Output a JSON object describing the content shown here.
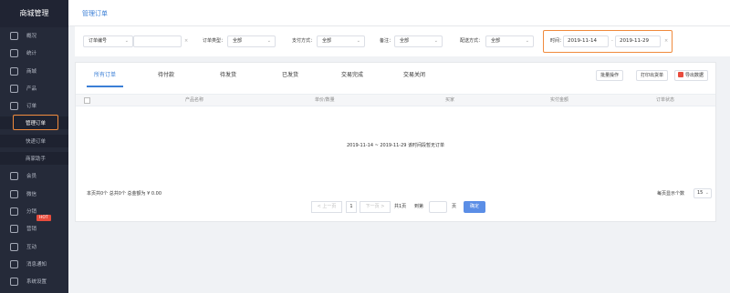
{
  "sidebar": {
    "brand": "商城管理",
    "items": [
      {
        "label": "概况",
        "icon": "monitor-icon"
      },
      {
        "label": "统计",
        "icon": "chart-icon"
      },
      {
        "label": "商城",
        "icon": "store-icon"
      },
      {
        "label": "产品",
        "icon": "grid-icon"
      },
      {
        "label": "订单",
        "icon": "clipboard-icon"
      },
      {
        "label": "会员",
        "icon": "user-group-icon"
      },
      {
        "label": "微信",
        "icon": "wechat-icon"
      },
      {
        "label": "分销",
        "icon": "share-icon"
      },
      {
        "label": "营销",
        "icon": "tag-icon"
      },
      {
        "label": "互动",
        "icon": "chat-icon"
      },
      {
        "label": "消息通知",
        "icon": "bell-icon"
      },
      {
        "label": "系统设置",
        "icon": "gear-icon"
      }
    ],
    "sub_items": [
      "管理订单",
      "快递订单",
      "商家助手"
    ],
    "hot_badge": "HOT"
  },
  "header": {
    "title": "管理订单"
  },
  "filters": {
    "order_no_select": "订单编号",
    "order_type_label": "订单类型：",
    "order_type_value": "全部",
    "pay_label": "支付方式：",
    "pay_value": "全部",
    "remark_label": "备注：",
    "remark_value": "全部",
    "delivery_label": "配送方式：",
    "delivery_value": "全部",
    "time_label": "时间：",
    "date_start": "2019-11-14",
    "date_end": "2019-11-29",
    "date_sep": "-",
    "clear": "×"
  },
  "tabs": [
    "所有订单",
    "待付款",
    "待发货",
    "已发货",
    "交易完成",
    "交易关闭"
  ],
  "toolbar": {
    "batch": "批量操作",
    "print": "打印出货单",
    "export": "导出数据"
  },
  "table": {
    "columns": [
      "产品名称",
      "单价/数量",
      "买家",
      "实付金额",
      "订单状态"
    ],
    "empty_text": "2019-11-14 ~ 2019-11-29 该时间段暂无订单"
  },
  "footer": {
    "summary": "本页共0个  总共0个  总金额为 ¥ 0.00",
    "page_size_label": "每页显示个数",
    "page_size_value": "15",
    "prev": "< 上一页",
    "page_num": "1",
    "next": "下一页 >",
    "total_pages": "共1页",
    "goto_label": "到第",
    "goto_unit": "页",
    "confirm": "确定"
  },
  "colors": {
    "accent": "#3b7fd6",
    "highlight": "#f08a3c",
    "sidebar_bg": "#252a39",
    "hot": "#e84c3d"
  }
}
